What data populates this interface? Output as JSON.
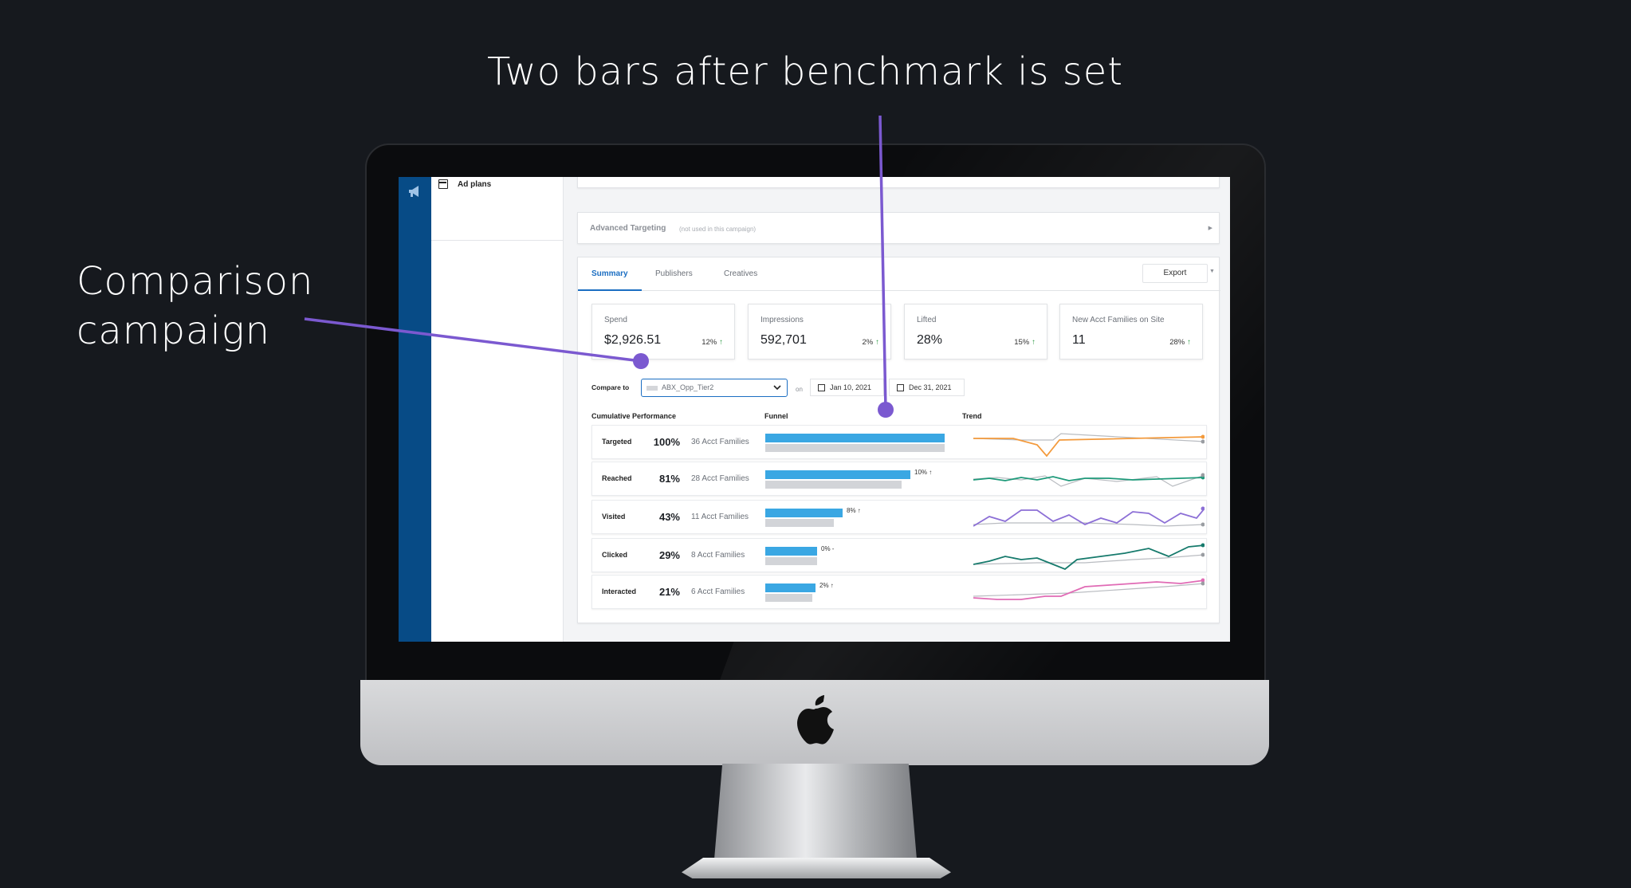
{
  "annotations": {
    "top_title": "Two bars after benchmark is set",
    "left_title_line1": "Comparison",
    "left_title_line2": "campaign",
    "line_color": "#7b59d0"
  },
  "sidebar": {
    "nav_icon": "megaphone-icon",
    "item_icon": "calendar-icon",
    "item_label": "Ad plans"
  },
  "advanced_targeting": {
    "title": "Advanced Targeting",
    "note": "(not used in this campaign)"
  },
  "tabs": [
    {
      "label": "Summary",
      "active": true
    },
    {
      "label": "Publishers",
      "active": false
    },
    {
      "label": "Creatives",
      "active": false
    }
  ],
  "export_label": "Export",
  "metrics": [
    {
      "label": "Spend",
      "value": "$2,926.51",
      "change": "12%",
      "direction": "up"
    },
    {
      "label": "Impressions",
      "value": "592,701",
      "change": "2%",
      "direction": "up"
    },
    {
      "label": "Lifted",
      "value": "28%",
      "change": "15%",
      "direction": "up"
    },
    {
      "label": "New Acct Families on Site",
      "value": "11",
      "change": "28%",
      "direction": "up"
    }
  ],
  "compare": {
    "label": "Compare to",
    "value": "ABX_Opp_Tier2",
    "on_label": "on",
    "start_date": "Jan 10, 2021",
    "end_date": "Dec 31, 2021"
  },
  "columns": {
    "cumulative": "Cumulative Performance",
    "funnel": "Funnel",
    "trend": "Trend"
  },
  "funnel_rows": [
    {
      "stage": "Targeted",
      "pct": "100%",
      "count": "36 Acct Families",
      "current": 1.0,
      "benchmark": 1.0,
      "delta": "",
      "trend_color": "#f39a3c"
    },
    {
      "stage": "Reached",
      "pct": "81%",
      "count": "28 Acct Families",
      "current": 0.81,
      "benchmark": 0.76,
      "delta": "10% ↑",
      "trend_color": "#1e9a7a"
    },
    {
      "stage": "Visited",
      "pct": "43%",
      "count": "11 Acct Families",
      "current": 0.43,
      "benchmark": 0.38,
      "delta": "8% ↑",
      "trend_color": "#8c6fd6"
    },
    {
      "stage": "Clicked",
      "pct": "29%",
      "count": "8 Acct Families",
      "current": 0.29,
      "benchmark": 0.29,
      "delta": "0% -",
      "trend_color": "#167a6c"
    },
    {
      "stage": "Interacted",
      "pct": "21%",
      "count": "6 Acct Families",
      "current": 0.28,
      "benchmark": 0.26,
      "delta": "2% ↑",
      "trend_color": "#e06bb5"
    }
  ],
  "colors": {
    "nav_rail": "#074b86",
    "accent": "#1b6ec2",
    "bar_current": "#3aa7e3",
    "bar_benchmark": "#d2d4d8",
    "up": "#2e9b45"
  }
}
